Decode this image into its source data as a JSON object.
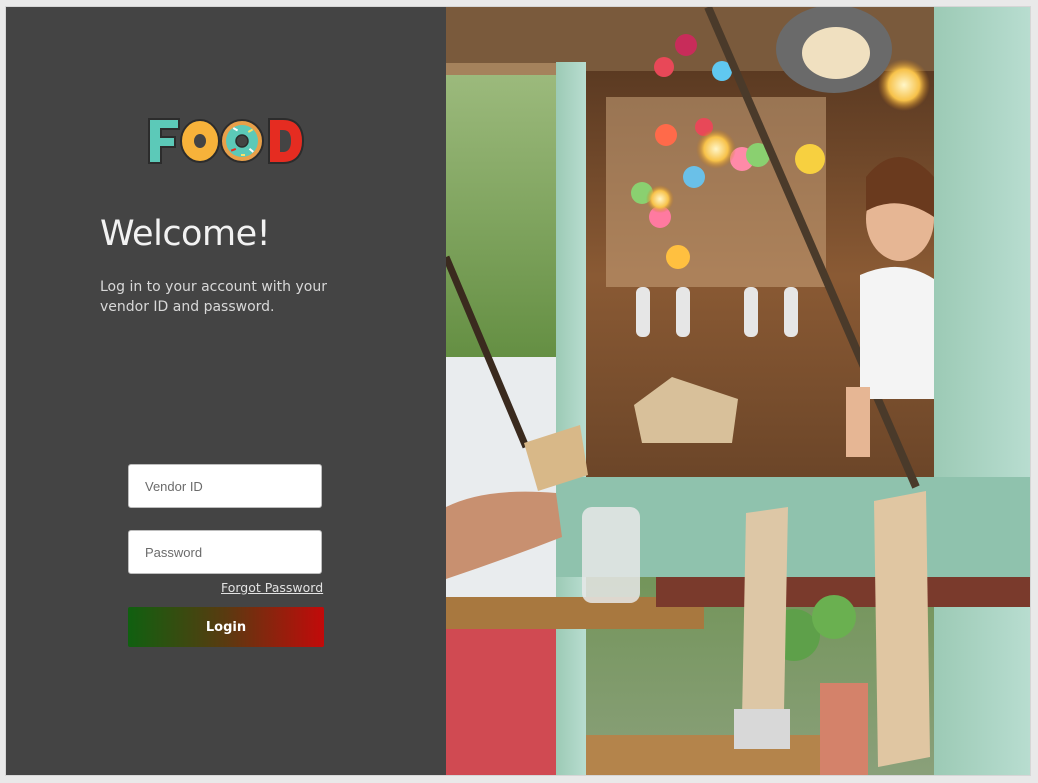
{
  "brand": {
    "logo_text": "FOOD",
    "logo_colors": [
      "#5cc9b8",
      "#f7b23a",
      "#f5a23a",
      "#e52c21"
    ]
  },
  "welcome": {
    "title": "Welcome!",
    "subtitle": "Log in to your account with your vendor ID and password."
  },
  "form": {
    "vendor_placeholder": "Vendor ID",
    "vendor_value": "",
    "password_placeholder": "Password",
    "password_value": "",
    "forgot_label": "Forgot Password",
    "login_label": "Login",
    "login_gradient": [
      "#106010",
      "#c20a0a"
    ]
  },
  "hero_image": {
    "icon": "food-truck-photo"
  }
}
